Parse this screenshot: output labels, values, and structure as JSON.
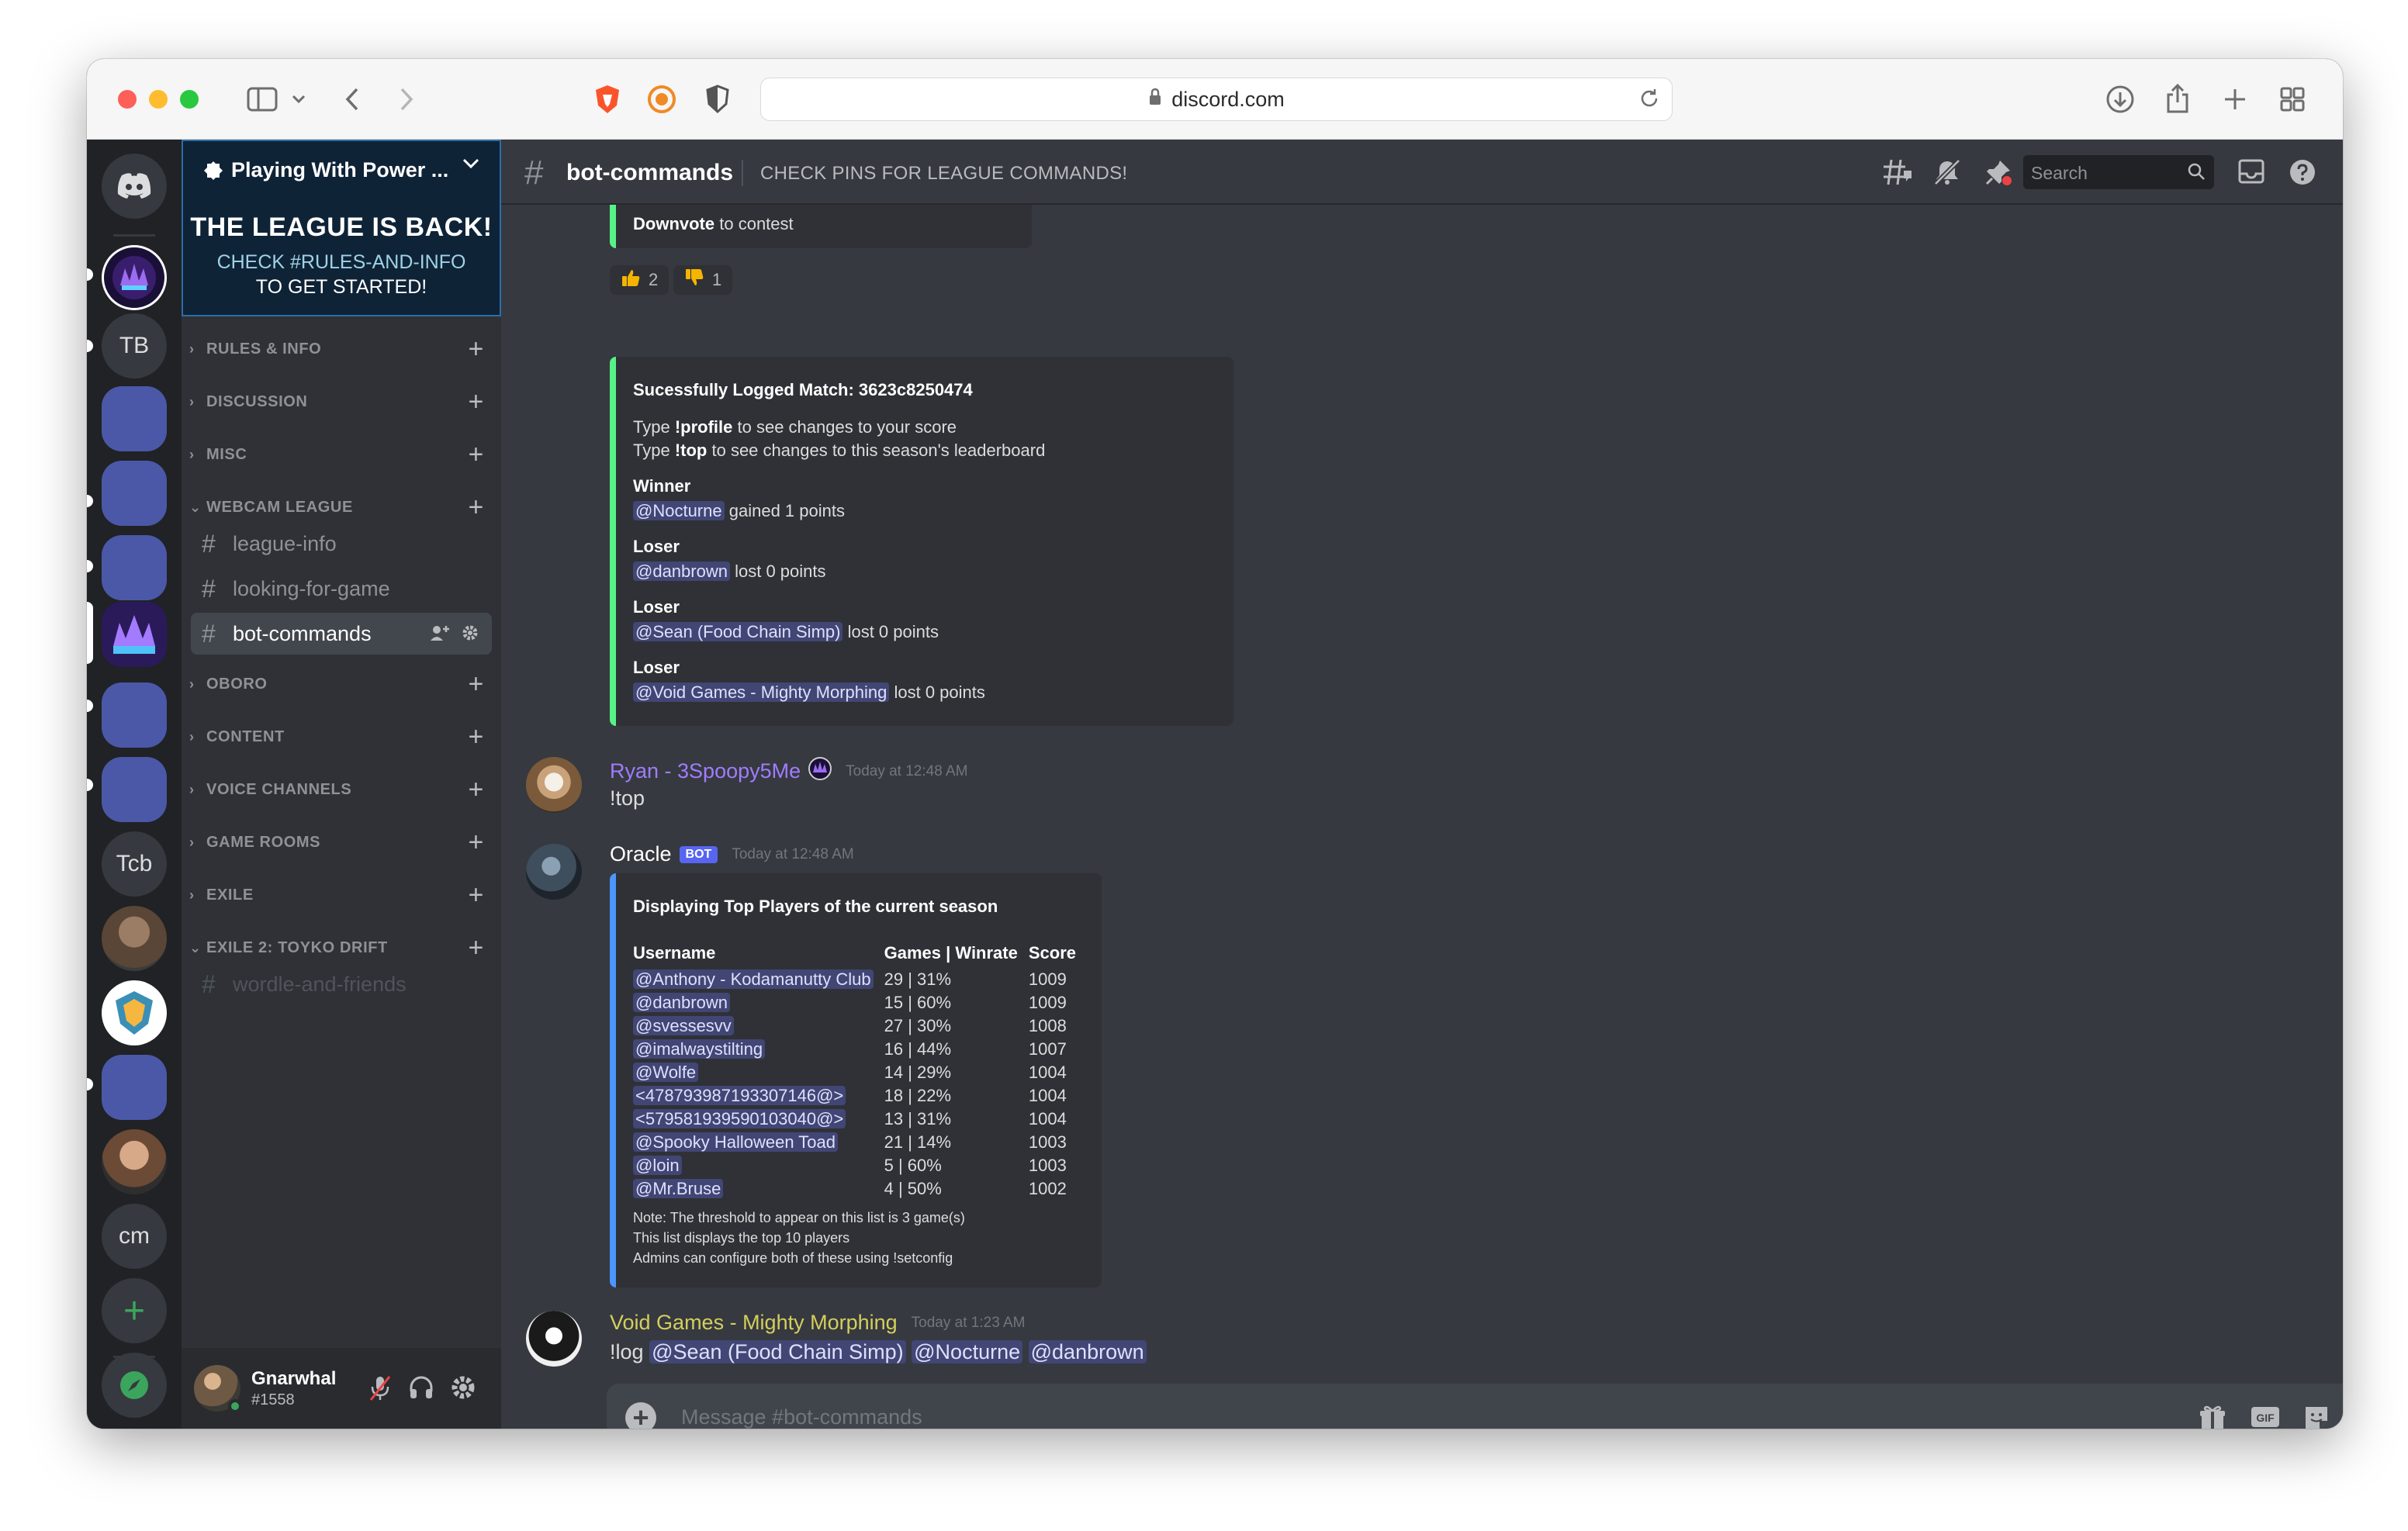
{
  "browser": {
    "url": "discord.com"
  },
  "rail": {
    "tb_label": "TB",
    "tcb_label": "Tcb",
    "cm_label": "cm",
    "add_label": "+"
  },
  "server": {
    "name": "Playing With Power ...",
    "banner_headline": "THE LEAGUE IS BACK!",
    "banner_line1": "CHECK #RULES-AND-INFO",
    "banner_line2": "TO GET STARTED!"
  },
  "categories": [
    {
      "label": "RULES & INFO"
    },
    {
      "label": "DISCUSSION"
    },
    {
      "label": "MISC"
    },
    {
      "label": "WEBCAM LEAGUE"
    },
    {
      "label": "OBORO"
    },
    {
      "label": "CONTENT"
    },
    {
      "label": "VOICE CHANNELS"
    },
    {
      "label": "GAME ROOMS"
    },
    {
      "label": "EXILE"
    },
    {
      "label": "EXILE 2: TOYKO DRIFT"
    }
  ],
  "channels": {
    "league_info": "league-info",
    "looking_for_game": "looking-for-game",
    "bot_commands": "bot-commands",
    "wordle": "wordle-and-friends"
  },
  "user": {
    "name": "Gnarwhal",
    "tag": "#1558"
  },
  "header": {
    "channel": "bot-commands",
    "topic": "CHECK PINS FOR LEAGUE COMMANDS!",
    "search_placeholder": "Search"
  },
  "messages": {
    "vote_tail_bold": "Downvote",
    "vote_tail_text": "to contest",
    "reaction_up": "2",
    "reaction_down": "1",
    "match": {
      "title": "Sucessfully Logged Match: 3623c8250474",
      "line1_pre": "Type",
      "line1_cmd": "!profile",
      "line1_post": "to see changes to your score",
      "line2_pre": "Type",
      "line2_cmd": "!top",
      "line2_post": "to see changes to this season's leaderboard",
      "winner_label": "Winner",
      "winner_name": "@Nocturne",
      "winner_result": "gained 1 points",
      "loser_label": "Loser",
      "loser1_name": "@danbrown",
      "loser1_result": "lost 0 points",
      "loser2_name": "@Sean (Food Chain Simp)",
      "loser2_result": "lost 0 points",
      "loser3_name": "@Void Games - Mighty Morphing",
      "loser3_result": "lost 0 points"
    },
    "ryan": {
      "author": "Ryan - 3Spoopy5Me",
      "author_color": "#a07cff",
      "time": "Today at 12:48 AM",
      "text": "!top"
    },
    "oracle": {
      "author": "Oracle",
      "bot_tag": "BOT",
      "time": "Today at 12:48 AM",
      "title": "Displaying Top Players of the current season",
      "col_user": "Username",
      "col_games": "Games | Winrate",
      "col_score": "Score",
      "rows": [
        {
          "user": "@Anthony - Kodamanutty Club",
          "games": "29 | 31%",
          "score": "1009"
        },
        {
          "user": "@danbrown",
          "games": "15 | 60%",
          "score": "1009"
        },
        {
          "user": "@svessesvv",
          "games": "27 | 30%",
          "score": "1008"
        },
        {
          "user": "@imalwaystilting",
          "games": "16 | 44%",
          "score": "1007"
        },
        {
          "user": "@Wolfe",
          "games": "14 | 29%",
          "score": "1004"
        },
        {
          "user": "<478793987193307146@>",
          "games": "18 | 22%",
          "score": "1004"
        },
        {
          "user": "<579581939590103040@>",
          "games": "13 | 31%",
          "score": "1004"
        },
        {
          "user": "@Spooky Halloween Toad",
          "games": "21 | 14%",
          "score": "1003"
        },
        {
          "user": "@loin",
          "games": "5 | 60%",
          "score": "1003"
        },
        {
          "user": "@Mr.Bruse",
          "games": "4 | 50%",
          "score": "1002"
        }
      ],
      "note1": "Note: The threshold to appear on this list is 3 game(s)",
      "note2": "This list displays the top 10 players",
      "note3": "Admins can configure both of these using !setconfig"
    },
    "void": {
      "author": "Void Games - Mighty Morphing",
      "author_color": "#d4cf5c",
      "time": "Today at 1:23 AM",
      "cmd": "!log",
      "m1": "@Sean (Food Chain Simp)",
      "m2": "@Nocturne",
      "m3": "@danbrown"
    }
  },
  "composer": {
    "placeholder": "Message #bot-commands",
    "gif_label": "GIF"
  },
  "colors": {
    "accent": "#5865f2",
    "embed_green": "#57f287",
    "embed_blue": "#4b96ff",
    "online": "#3ba55d"
  }
}
